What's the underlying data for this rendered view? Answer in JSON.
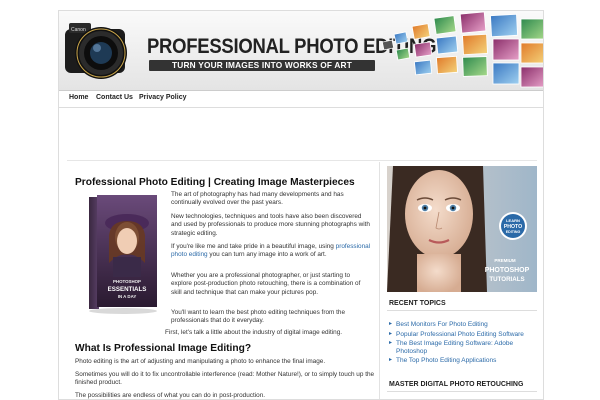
{
  "header": {
    "title": "PROFESSIONAL PHOTO EDITING",
    "tagline": "TURN YOUR IMAGES INTO WORKS OF ART",
    "camera_brand": "Canon"
  },
  "nav": {
    "items": [
      {
        "label": "Home"
      },
      {
        "label": "Contact Us"
      },
      {
        "label": "Privacy Policy"
      }
    ]
  },
  "post": {
    "title": "Professional Photo Editing | Creating Image Masterpieces",
    "book": {
      "title_lines": [
        "PHOTOSHOP",
        "ESSENTIALS",
        "IN A DAY"
      ]
    },
    "p1": "The art of photography has had many developments and has continually evolved over the past years.",
    "p2": "New technologies, techniques and tools have also been discovered and used by professionals to produce more stunning photographs with strategic editing.",
    "p3_before": "If you're like me and take pride in a beautiful image, using ",
    "p3_link": "professional photo editing",
    "p3_after": " you can turn any image into a work of art.",
    "p4": "Whether you are a professional photographer, or just starting to explore post-production photo retouching, there is a combination of skill and technique that can make your pictures pop.",
    "p5": "You'll want to learn the best photo editing techniques from the professionals that do it everyday.",
    "p6": "First, let's talk a little about the industry of digital image editing.",
    "subheading": "What Is Professional Image Editing?",
    "p7": "Photo editing is the art of adjusting and manipulating a photo to enhance the final image.",
    "p8": "Sometimes you will do it to fix uncontrollable interference (read: Mother Nature!), or to simply touch up the finished product.",
    "p9": "The possibilities are endless of what you can do in post-production."
  },
  "sidebar": {
    "banner": {
      "badge_lines": [
        "LEARN",
        "PHOTO",
        "EDITING"
      ],
      "text_lines": [
        "PREMIUM",
        "PHOTOSHOP",
        "TUTORIALS"
      ]
    },
    "recent_heading": "RECENT TOPICS",
    "recent_items": [
      {
        "label": "Best Monitors For Photo Editing"
      },
      {
        "label": "Popular Professional Photo Editing Software"
      },
      {
        "label": "The Best Image Editing Software: Adobe Photoshop"
      },
      {
        "label": "The Top Photo Editing Applications"
      }
    ],
    "master_heading": "MASTER DIGITAL PHOTO RETOUCHING"
  },
  "colors": {
    "link": "#2b6aa8",
    "heading": "#111111",
    "tagline_bar": "#333333"
  }
}
